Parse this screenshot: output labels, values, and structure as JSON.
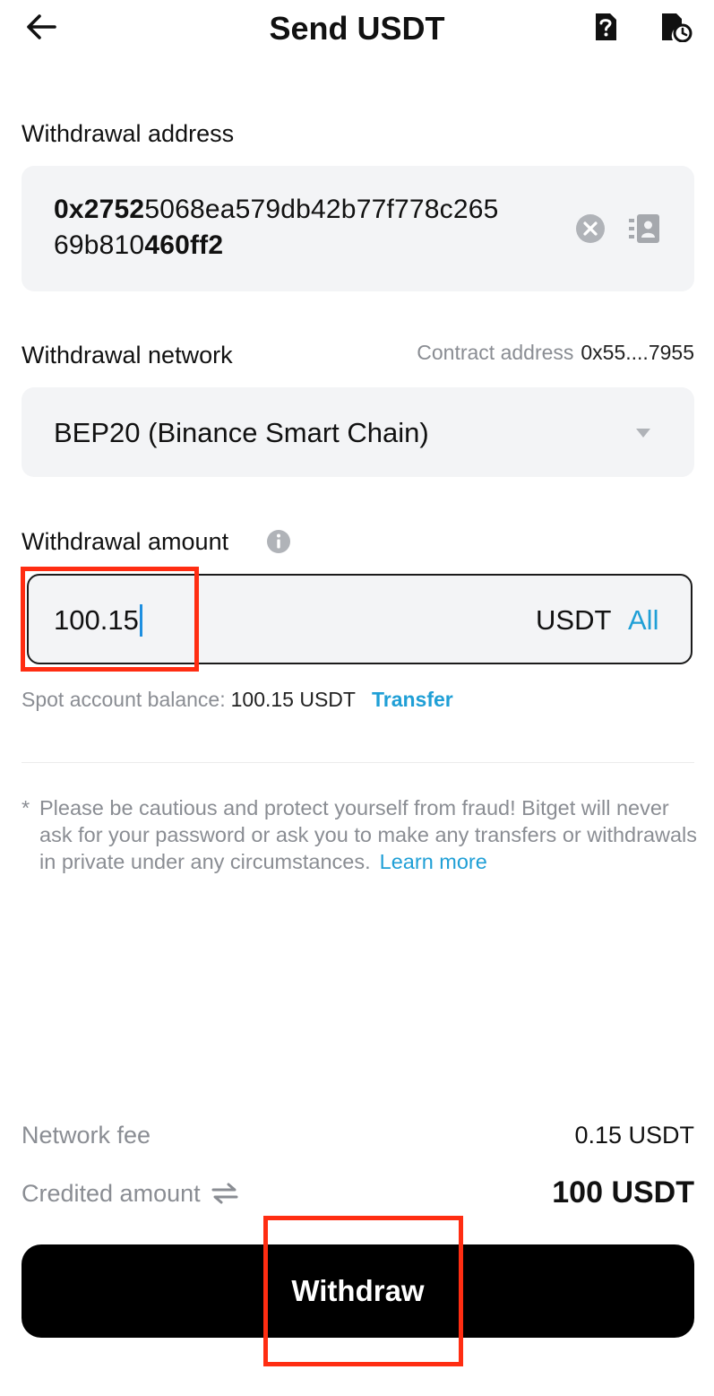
{
  "header": {
    "title": "Send USDT",
    "icons": {
      "back": "arrow-left-icon",
      "help": "help-document-icon",
      "history": "history-clock-icon"
    }
  },
  "address": {
    "label": "Withdrawal address",
    "value_prefix": "0x2752",
    "value_middle": "5068ea579db42b77f778c265",
    "value_middle2": "69b810",
    "value_suffix": "460ff2",
    "icons": {
      "clear": "clear-circle-icon",
      "address_book": "address-book-icon"
    }
  },
  "network": {
    "label": "Withdrawal network",
    "contract_label": "Contract address",
    "contract_value": "0x55....7955",
    "selected": "BEP20 (Binance Smart Chain)",
    "icons": {
      "dropdown": "caret-down-icon"
    }
  },
  "amount": {
    "label": "Withdrawal amount",
    "value": "100.15",
    "unit": "USDT",
    "all_label": "All",
    "icons": {
      "info": "info-circle-icon"
    }
  },
  "balance": {
    "label": "Spot account balance:",
    "value": "100.15 USDT",
    "transfer_label": "Transfer"
  },
  "warning": {
    "star": "*",
    "text": "Please be cautious and protect yourself from fraud! Bitget will never ask for your password or ask you to make any transfers or withdrawals in private under any circumstances.",
    "learn_more": "Learn more"
  },
  "summary": {
    "fee_label": "Network fee",
    "fee_value": "0.15 USDT",
    "credited_label": "Credited amount",
    "credited_value": "100 USDT",
    "icons": {
      "swap": "swap-arrows-icon"
    }
  },
  "footer": {
    "withdraw_label": "Withdraw"
  },
  "colors": {
    "accent": "#1f9fd6",
    "highlight": "#ff2d12",
    "button_bg": "#000000",
    "field_bg": "#f3f4f6",
    "muted": "#8a8d93"
  }
}
